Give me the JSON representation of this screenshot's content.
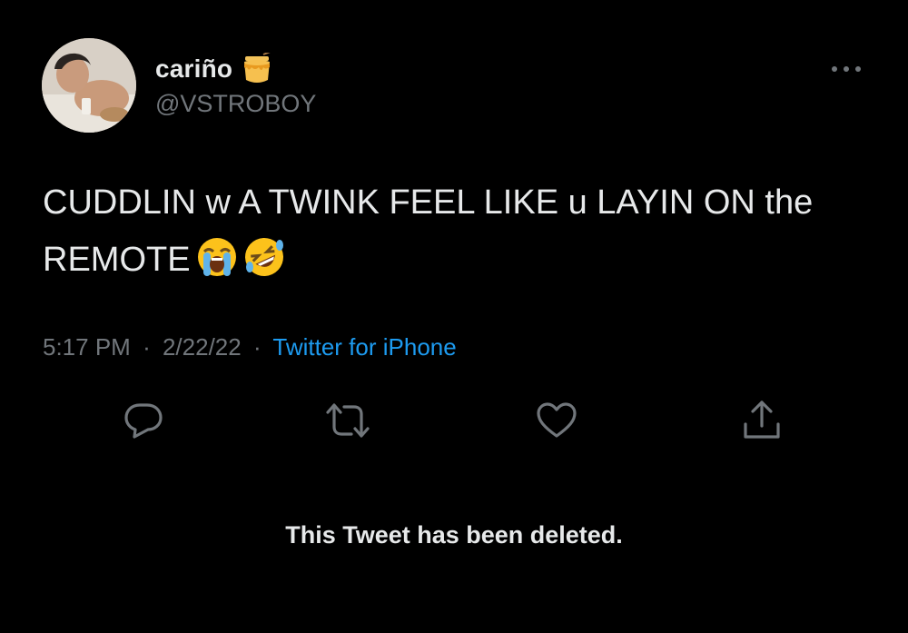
{
  "author": {
    "display_name": "cariño",
    "name_emoji": "honey-pot-icon",
    "handle": "@VSTROBOY",
    "avatar": "user-avatar-photo"
  },
  "tweet": {
    "text": "CUDDLIN w A TWINK FEEL LIKE u LAYIN ON the REMOTE",
    "emojis": [
      "loudly-crying-face-icon",
      "rolling-on-floor-laughing-icon"
    ],
    "time": "5:17 PM",
    "date": "2/22/22",
    "source": "Twitter for iPhone",
    "separator": "·"
  },
  "actions": [
    "reply-icon",
    "retweet-icon",
    "like-icon",
    "share-icon"
  ],
  "more_icon": "more-options-icon",
  "deleted_notice": "This Tweet has been deleted.",
  "colors": {
    "background": "#000000",
    "primary_text": "#e7e9ea",
    "secondary_text": "#71767b",
    "link": "#1d9bf0"
  }
}
